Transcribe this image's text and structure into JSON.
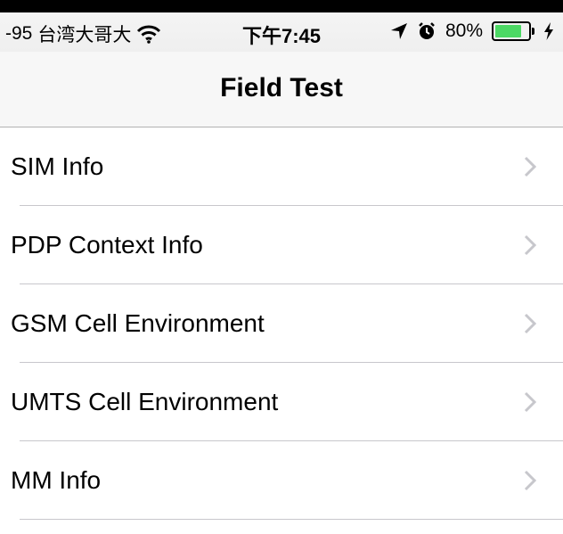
{
  "status_bar": {
    "signal": "-95",
    "carrier": "台湾大哥大",
    "time": "下午7:45",
    "battery_percent": "80%",
    "battery_level": 0.8,
    "battery_color": "#4cd964",
    "icons": [
      "wifi-icon",
      "location-arrow-icon",
      "alarm-icon",
      "battery-icon",
      "charging-bolt-icon"
    ]
  },
  "nav": {
    "title": "Field Test"
  },
  "rows": [
    {
      "label": "SIM Info"
    },
    {
      "label": "PDP Context Info"
    },
    {
      "label": "GSM Cell Environment"
    },
    {
      "label": "UMTS Cell Environment"
    },
    {
      "label": "MM Info"
    }
  ]
}
